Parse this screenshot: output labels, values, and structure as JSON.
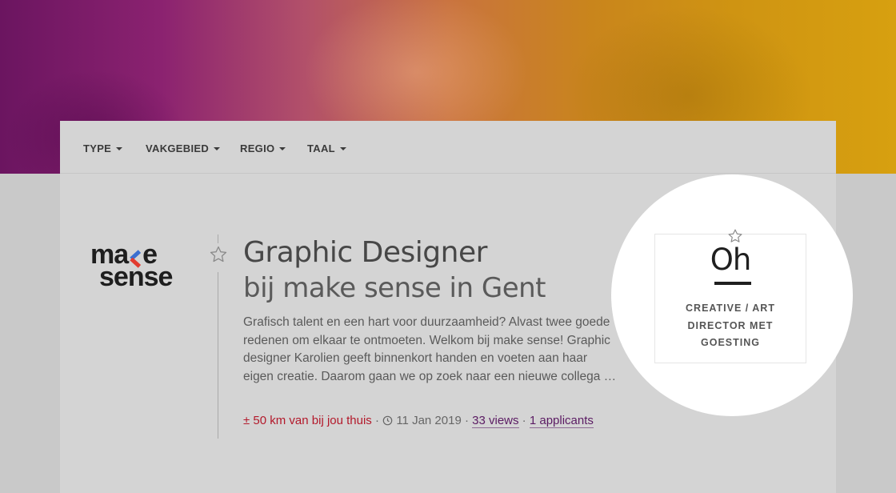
{
  "filters": [
    {
      "label": "TYPE"
    },
    {
      "label": "VAKGEBIED"
    },
    {
      "label": "REGIO"
    },
    {
      "label": "TAAL"
    }
  ],
  "job": {
    "company_logo_line1_a": "ma",
    "company_logo_line1_b": "e",
    "company_logo_line2": "sense",
    "title": "Graphic Designer",
    "subtitle": "bij make sense in Gent",
    "description": "Grafisch talent en een hart voor duurzaamheid? Alvast twee goede redenen om elkaar te ontmoeten. Welkom bij make sense! Graphic designer Karolien geeft binnenkort handen en voeten aan haar eigen creatie. Daarom gaan we op zoek naar een nieuwe collega …",
    "distance": "± 50 km van bij jou thuis",
    "sep": " · ",
    "date": "11 Jan 2019",
    "views": "33 views",
    "applicants": "1 applicants",
    "favorite_icon": "star-outline-icon"
  },
  "promo": {
    "logo": "Oh",
    "text_line1": "CREATIVE / ART",
    "text_line2": "DIRECTOR MET",
    "text_line3": "GOESTING",
    "favorite_icon": "star-outline-icon"
  },
  "colors": {
    "hero_start": "#6b1560",
    "hero_end": "#d7a010",
    "distance": "#b3192b",
    "link": "#5b1b63"
  }
}
